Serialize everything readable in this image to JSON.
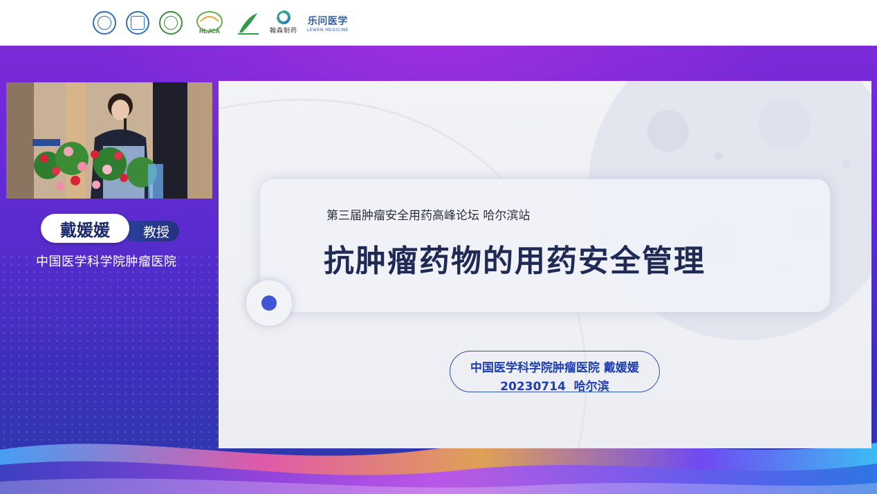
{
  "header": {
    "logos": [
      {
        "icon": "university-seal-icon",
        "color": "#2f6db5"
      },
      {
        "icon": "hospital-seal-icon",
        "color": "#2f6db5"
      },
      {
        "icon": "medical-association-seal-icon",
        "color": "#3c8a3c"
      },
      {
        "icon": "hljca-logo-icon",
        "text": "HLJCA"
      },
      {
        "icon": "leaf-logo-icon"
      },
      {
        "icon": "hanshen-pharma-logo-icon",
        "text": "翰森制药"
      },
      {
        "icon": "lewen-medicine-logo-icon",
        "text": "乐问医学",
        "subtext": "LEWEN MEDICINE"
      }
    ]
  },
  "speaker": {
    "name": "戴媛媛",
    "title": "教授",
    "affiliation": "中国医学科学院肿瘤医院"
  },
  "slide": {
    "subtitle": "第三届肿瘤安全用药高峰论坛 哈尔滨站",
    "title": "抗肿瘤药物的用药安全管理",
    "author_line": "中国医学科学院肿瘤医院 戴媛媛",
    "date_line": "20230714  哈尔滨"
  },
  "colors": {
    "accent": "#3f55d6",
    "title_text": "#1f2a55",
    "author_text": "#1f3fae",
    "background_purple": "#7d2ad8"
  }
}
